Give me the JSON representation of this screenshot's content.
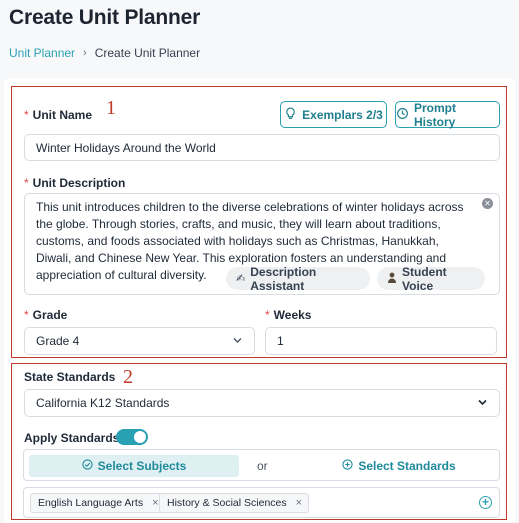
{
  "page": {
    "title": "Create Unit Planner"
  },
  "breadcrumb": {
    "parent": "Unit Planner",
    "separator": "›",
    "current": "Create Unit Planner"
  },
  "annotations": {
    "box1": "1",
    "box2": "2"
  },
  "unit_name": {
    "required_mark": "*",
    "label": "Unit Name",
    "value": "Winter Holidays Around the World"
  },
  "buttons": {
    "exemplars": "Exemplars 2/3",
    "prompt_history": "Prompt History"
  },
  "unit_description": {
    "required_mark": "*",
    "label": "Unit Description",
    "value": "This unit introduces children to the diverse celebrations of winter holidays across the globe. Through stories, crafts, and music, they will learn about traditions, customs, and foods associated with holidays such as Christmas, Hanukkah, Diwali, and Chinese New Year. This exploration fosters an understanding and appreciation of cultural diversity.",
    "description_assistant": "Description Assistant",
    "student_voice": "Student Voice"
  },
  "grade": {
    "required_mark": "*",
    "label": "Grade",
    "value": "Grade 4"
  },
  "weeks": {
    "required_mark": "*",
    "label": "Weeks",
    "value": "1"
  },
  "state_standards": {
    "label": "State Standards",
    "value": "California K12 Standards"
  },
  "apply_standards": {
    "label": "Apply Standards",
    "enabled": true
  },
  "subjects": {
    "select_subjects": "Select Subjects",
    "or": "or",
    "select_standards": "Select Standards"
  },
  "tags": [
    {
      "label": "English Language Arts",
      "remove": "×"
    },
    {
      "label": "History & Social Sciences",
      "remove": "×"
    }
  ],
  "colors": {
    "accent": "#2aa1b3",
    "annotation": "#c0392b",
    "required": "#e04848"
  }
}
